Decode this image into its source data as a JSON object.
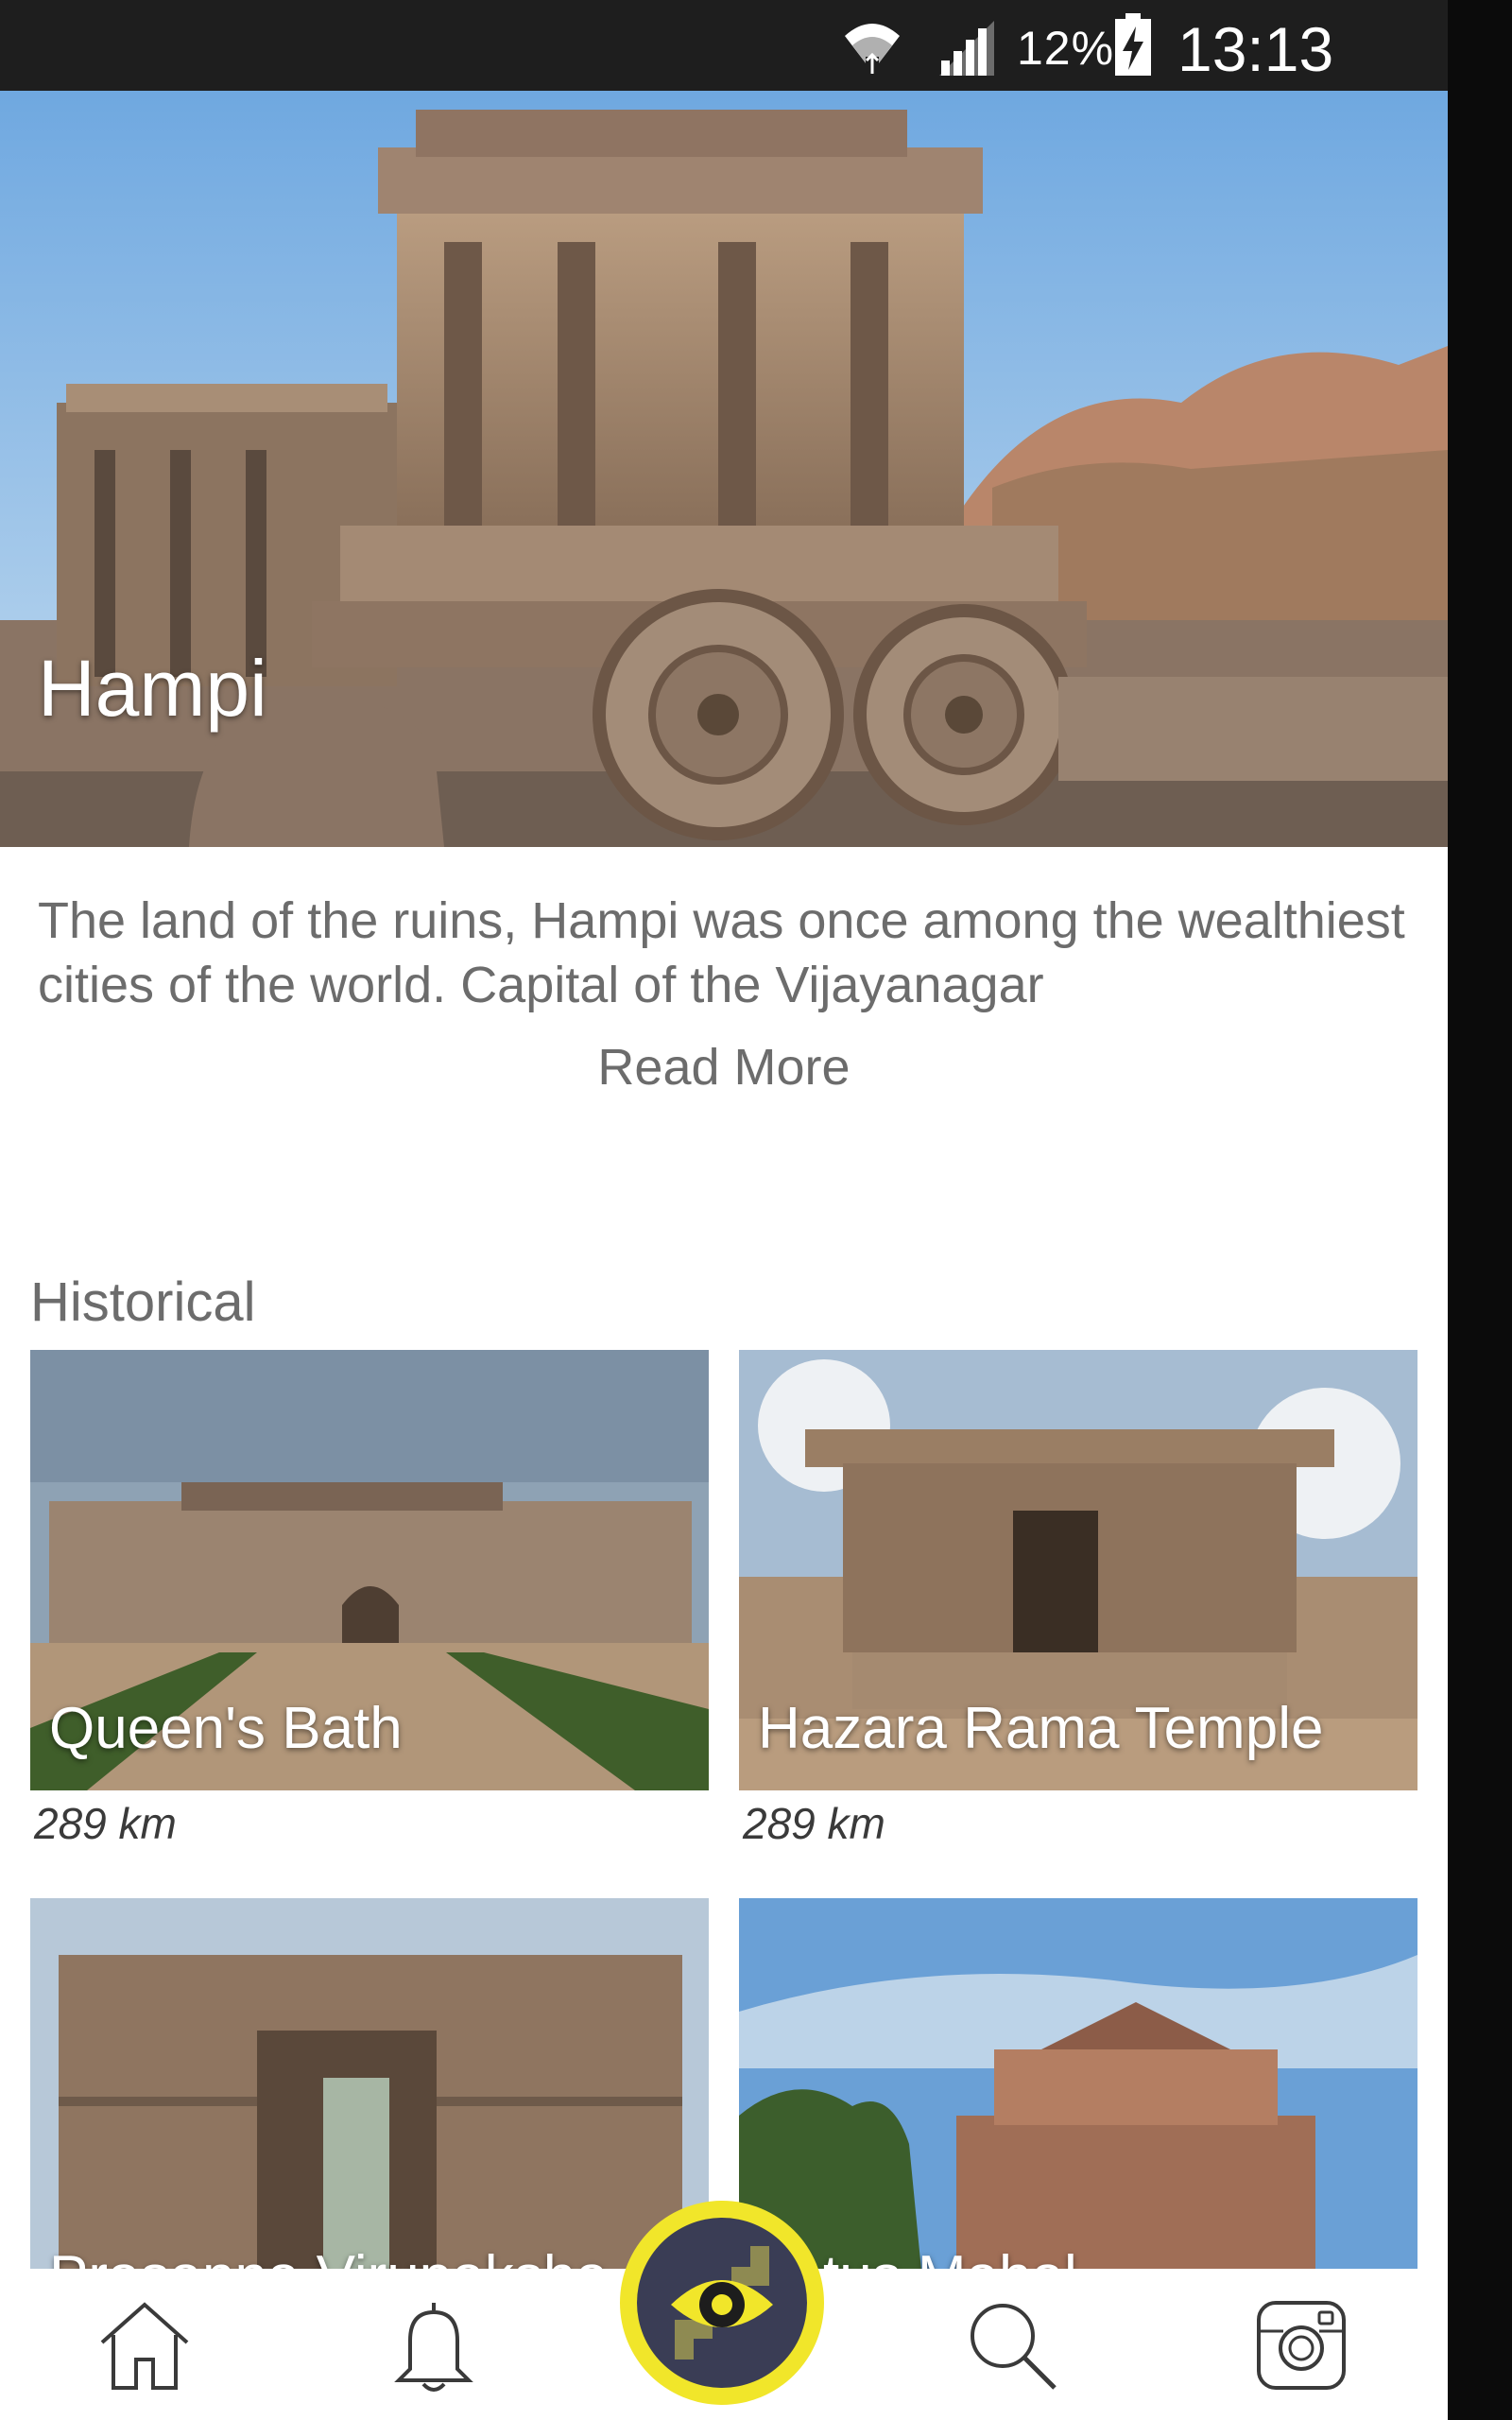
{
  "status_bar": {
    "battery_percent": "12%",
    "time": "13:13",
    "icons": [
      "wifi-icon",
      "signal-icon",
      "battery-charging-icon"
    ]
  },
  "hero": {
    "title": "Hampi",
    "description": "The land of the ruins, Hampi was once among the wealthiest cities of the world. Capital of the Vijayanagar",
    "read_more": "Read More"
  },
  "section": {
    "title": "Historical"
  },
  "places": [
    {
      "name": "Queen's Bath",
      "distance": "289 km"
    },
    {
      "name": "Hazara Rama Temple",
      "distance": "289 km"
    },
    {
      "name": "Prasanna Virupaksha",
      "distance": ""
    },
    {
      "name": "Lotus Mahal",
      "distance": ""
    }
  ],
  "bottom_nav": {
    "items": [
      "home-icon",
      "bell-icon",
      "eye-icon",
      "search-icon",
      "instagram-icon"
    ],
    "accent_color": "#f1e62a",
    "fab_color": "#3a3d55"
  }
}
